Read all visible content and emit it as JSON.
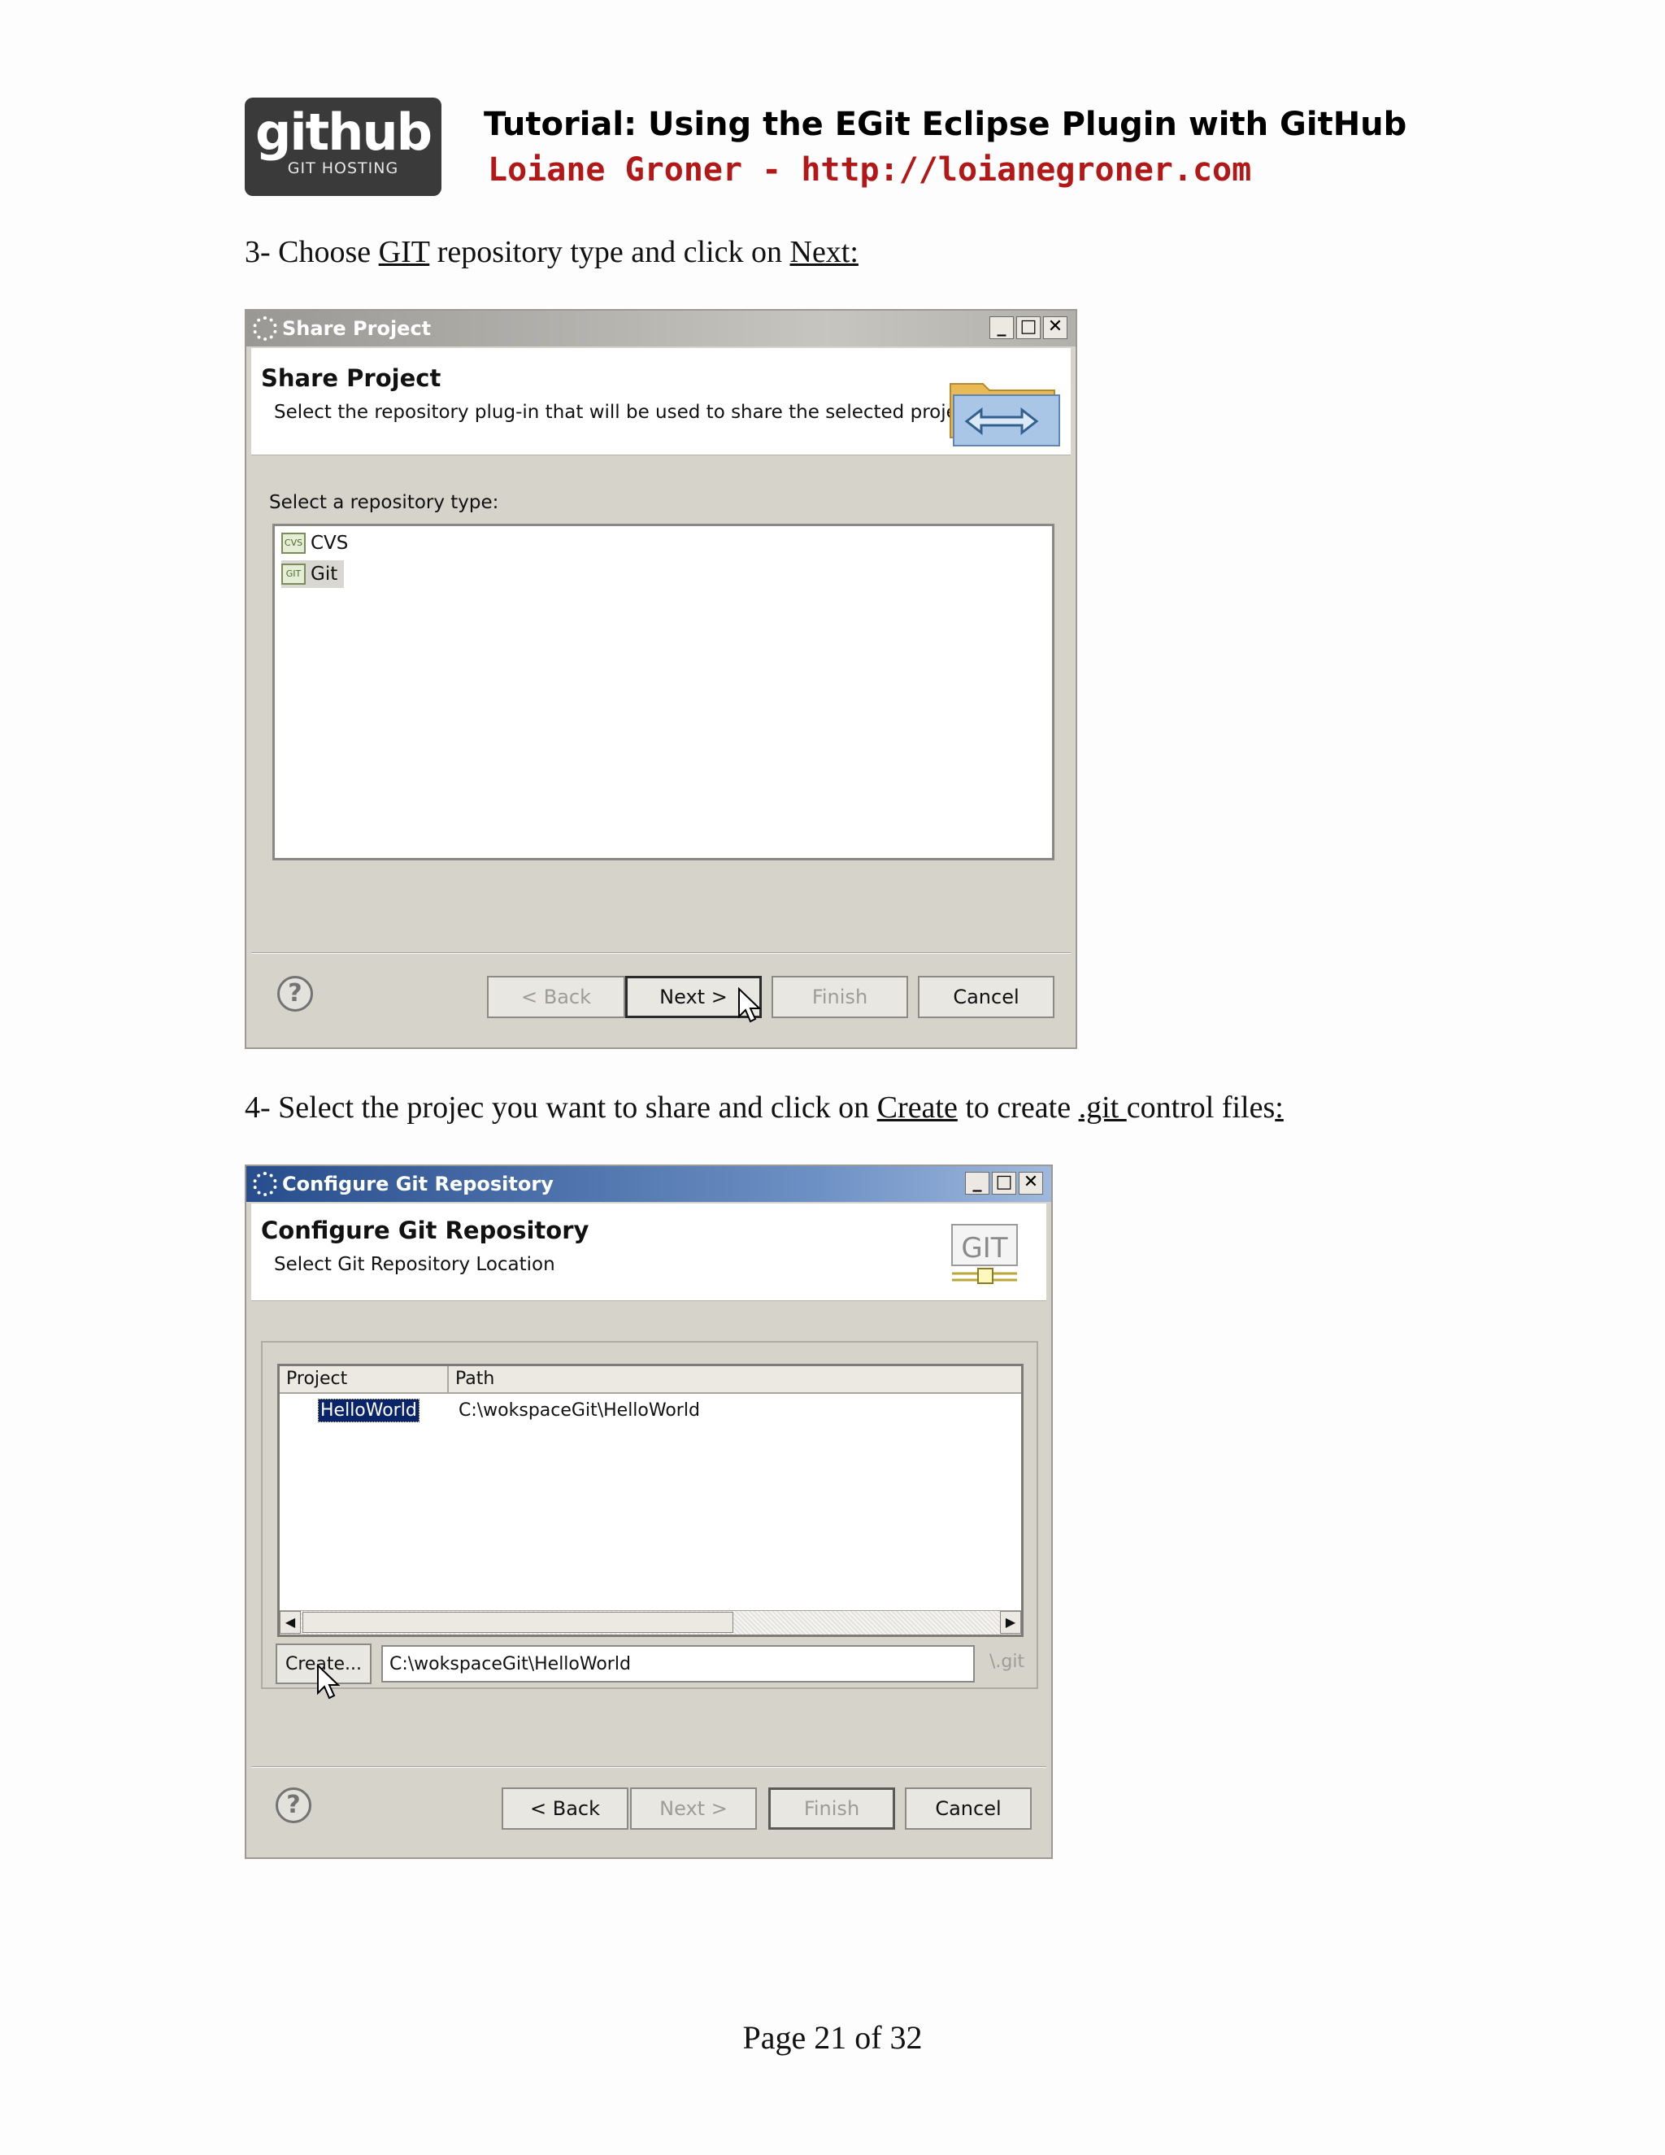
{
  "header": {
    "logo_main": "github",
    "logo_sub": "GIT HOSTING",
    "title": "Tutorial: Using the EGit Eclipse Plugin with GitHub",
    "author": "Loiane Groner - http://loianegroner.com"
  },
  "step3": {
    "prefix": "3- Choose ",
    "u1": "GIT",
    "mid": " repository type and click on ",
    "u2": "Next:"
  },
  "dialog1": {
    "window_title": "Share Project",
    "banner_title": "Share Project",
    "banner_subtitle": "Select the repository plug-in that will be used to share the selected project.",
    "list_label": "Select a repository type:",
    "items": [
      {
        "label": "CVS",
        "icon": "CVS"
      },
      {
        "label": "Git",
        "icon": "GIT"
      }
    ],
    "buttons": {
      "back": "< Back",
      "next": "Next >",
      "finish": "Finish",
      "cancel": "Cancel"
    }
  },
  "step4": {
    "prefix": "4- Select the projec you want to share and click on ",
    "u1": "Create",
    "mid": " to create ",
    "u2": ".git ",
    "mid2": "control files",
    "u3": ":"
  },
  "dialog2": {
    "window_title": "Configure Git Repository",
    "banner_title": "Configure Git Repository",
    "banner_subtitle": "Select Git Repository Location",
    "logo_text": "GIT",
    "columns": [
      "Project",
      "Path"
    ],
    "row": {
      "project": "HelloWorld",
      "path": "C:\\wokspaceGit\\HelloWorld"
    },
    "create_button": "Create...",
    "location_value": "C:\\wokspaceGit\\HelloWorld",
    "suffix": "\\.git",
    "buttons": {
      "back": "< Back",
      "next": "Next >",
      "finish": "Finish",
      "cancel": "Cancel"
    }
  },
  "footer": {
    "page": "Page 21 of 32"
  }
}
